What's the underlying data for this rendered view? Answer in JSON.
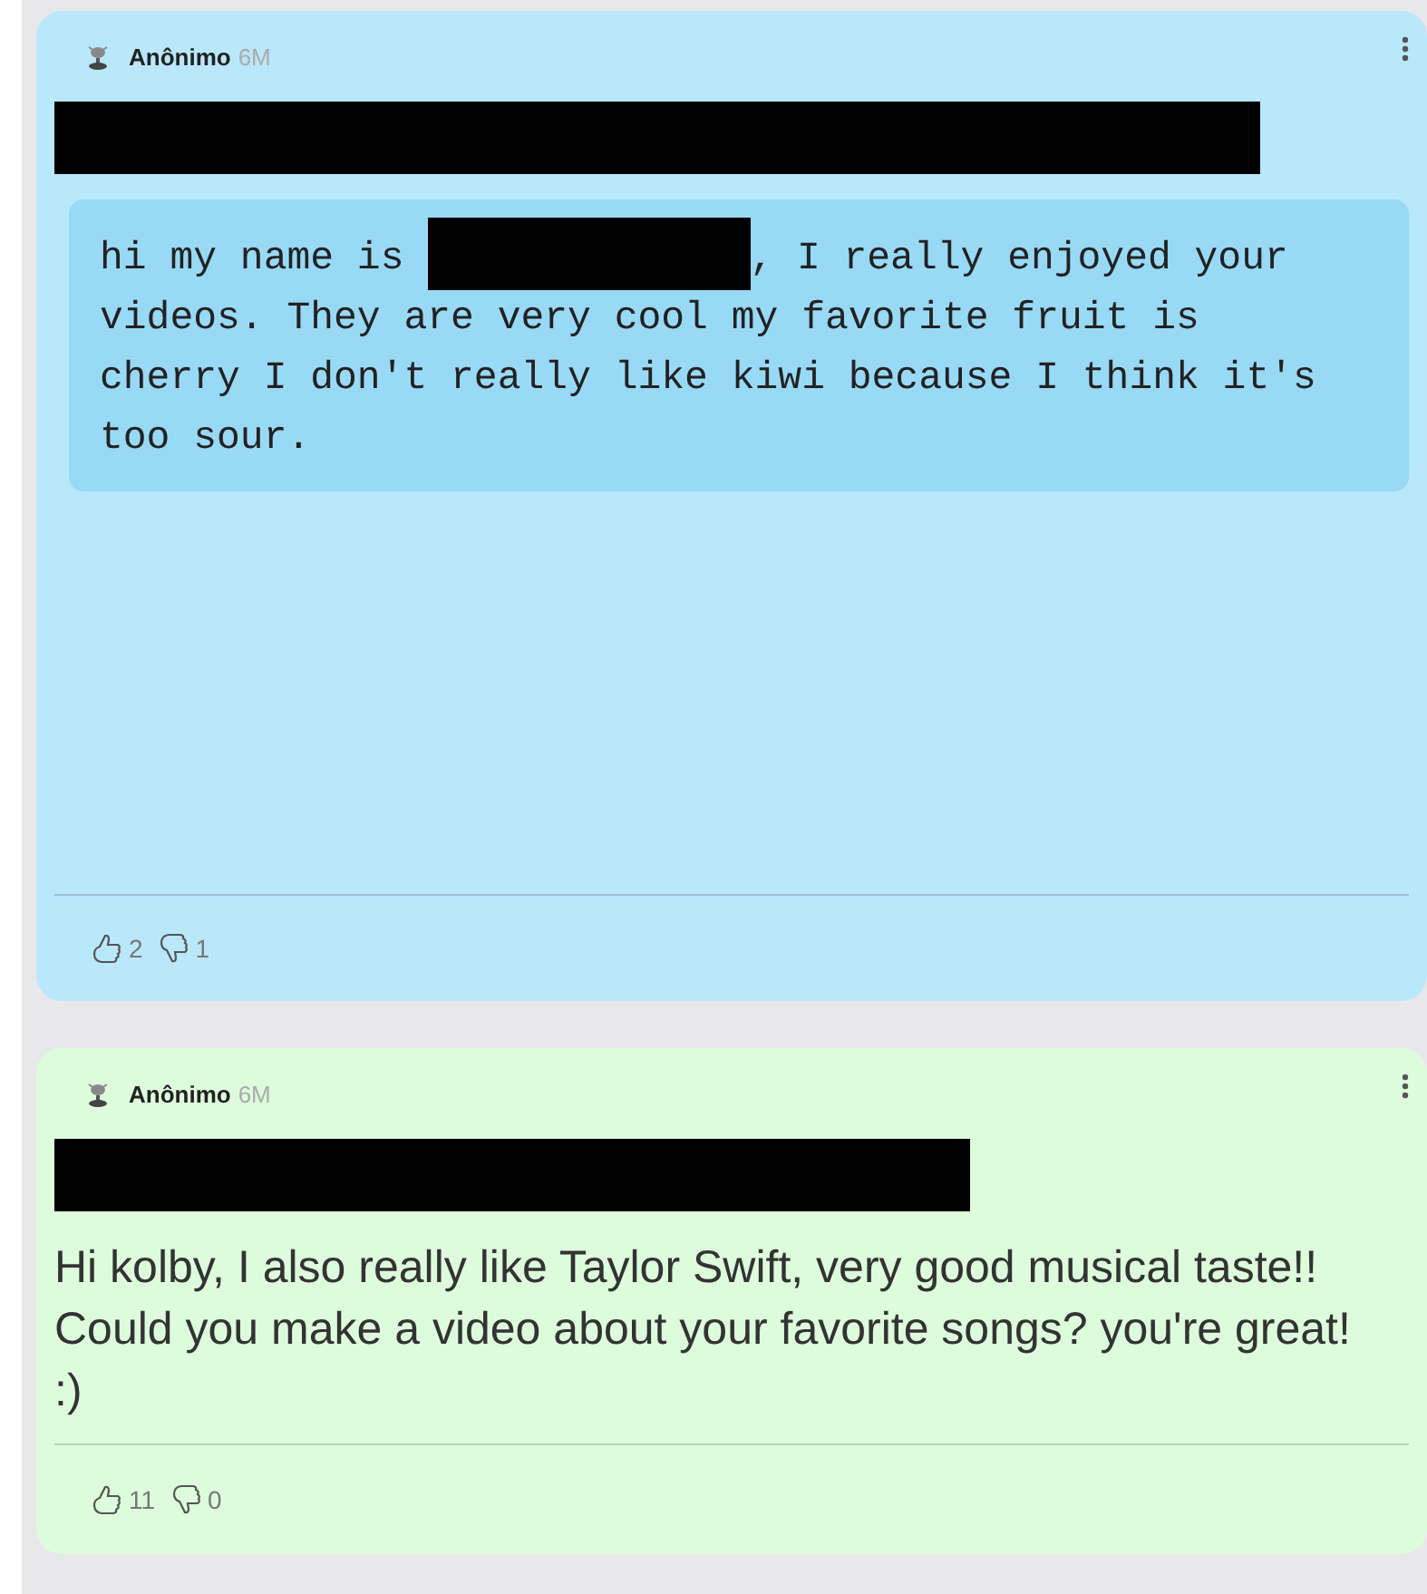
{
  "posts": [
    {
      "author": "Anônimo",
      "time": "6M",
      "color": "#b9e8fb",
      "title_redacted": true,
      "kind": "code",
      "body": [
        {
          "kind": "text",
          "text": "hi my name is "
        },
        {
          "kind": "redaction"
        },
        {
          "kind": "text",
          "text": ", I really enjoyed your videos. They are very cool my favorite fruit is cherry I don't really like kiwi because I think it's too sour."
        }
      ],
      "likes": "2",
      "dislikes": "1"
    },
    {
      "author": "Anônimo",
      "time": "6M",
      "color": "#ddfcdc",
      "title_redacted": true,
      "kind": "text",
      "body": [
        {
          "kind": "text",
          "text": "Hi kolby, I also really like Taylor Swift, very good musical taste!! Could you make a video about your favorite songs? you're great! :)"
        }
      ],
      "likes": "11",
      "dislikes": "0"
    }
  ]
}
